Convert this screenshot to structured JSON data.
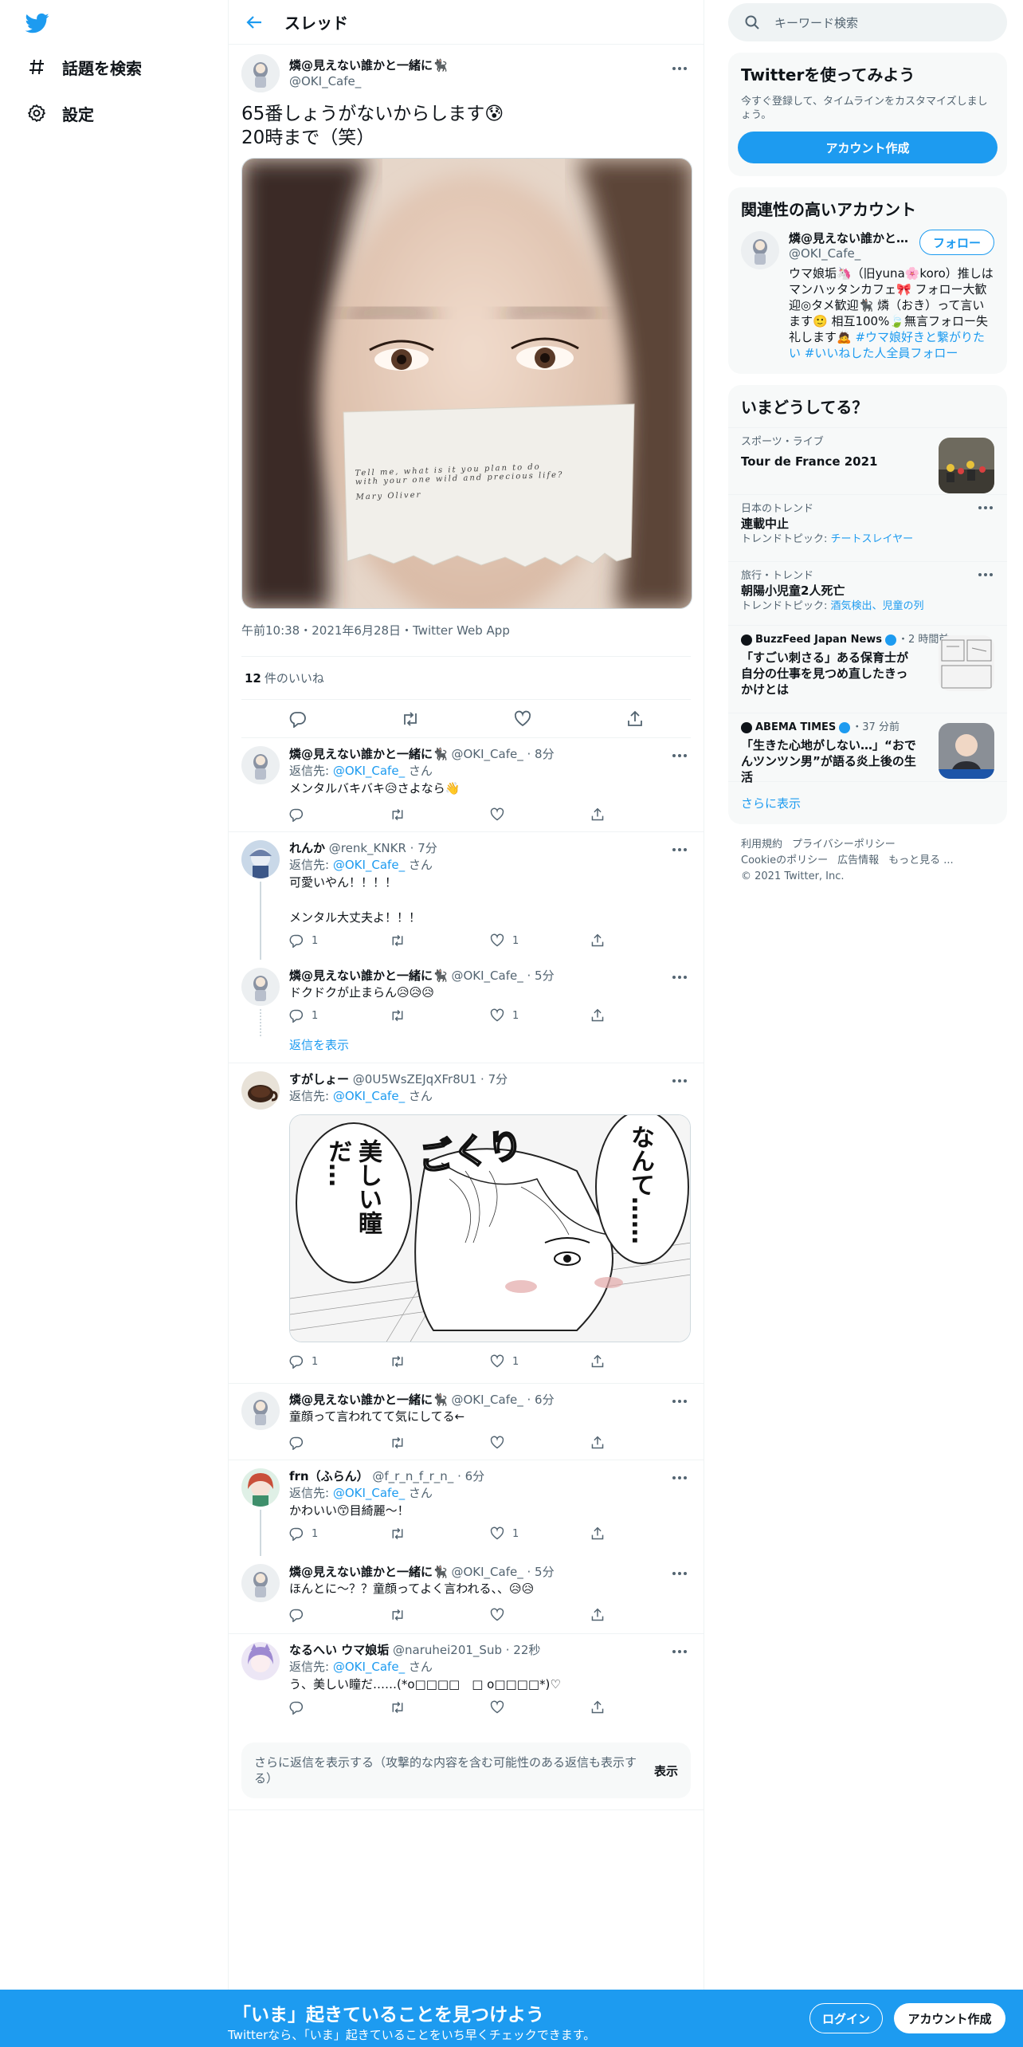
{
  "nav": {
    "explore": "話題を検索",
    "settings": "設定"
  },
  "header": {
    "title": "スレッド"
  },
  "main_tweet": {
    "display_name": "燐@見えない誰かと一緒に🐈‍⬛",
    "username": "@OKI_Cafe_",
    "text_line1": "65番しょうがないからします😰",
    "text_line2": "20時まで（笑）",
    "note_line1": "Tell me, what is it you plan to do",
    "note_line2": "with your one wild and precious life?",
    "note_author": "Mary Oliver",
    "timestamp": "午前10:38・2021年6月28日・Twitter Web App",
    "likes_count": "12",
    "likes_label": "件のいいね"
  },
  "replies": [
    {
      "display_name": "燐@見えない誰かと一緒に🐈‍⬛",
      "username": "@OKI_Cafe_",
      "time": "8分",
      "to_prefix": "返信先: ",
      "to_user": "@OKI_Cafe_",
      "to_suffix": "さん",
      "text": "メンタルバキバキ😥さよなら👋",
      "reply_count": "",
      "like_count": ""
    },
    {
      "display_name": "れんか",
      "username": "@renk_KNKR",
      "time": "7分",
      "to_prefix": "返信先: ",
      "to_user": "@OKI_Cafe_",
      "to_suffix": "さん",
      "text1": "可愛いやん！！！！",
      "text2": "メンタル大丈夫よ！！！",
      "reply_count": "1",
      "like_count": "1"
    },
    {
      "display_name": "燐@見えない誰かと一緒に🐈‍⬛",
      "username": "@OKI_Cafe_",
      "time": "5分",
      "text": "ドクドクが止まらん😥😥😥",
      "reply_count": "1",
      "like_count": "1"
    },
    {
      "display_name": "すがしょー",
      "username": "@0U5WsZEJqXFr8U1",
      "time": "7分",
      "to_prefix": "返信先: ",
      "to_user": "@OKI_Cafe_",
      "to_suffix": "さん",
      "manga_bubble1": "美しい瞳だ…",
      "manga_bubble2": "なんて……",
      "manga_sfx": "ごくり",
      "reply_count": "1",
      "like_count": "1"
    },
    {
      "display_name": "燐@見えない誰かと一緒に🐈‍⬛",
      "username": "@OKI_Cafe_",
      "time": "6分",
      "text": "童顔って言われてて気にしてる←"
    },
    {
      "display_name": "frn（ふらん）",
      "username": "@f_r_n_f_r_n_",
      "time": "6分",
      "to_prefix": "返信先: ",
      "to_user": "@OKI_Cafe_",
      "to_suffix": "さん",
      "text": "かわいい😙目綺麗〜！",
      "reply_count": "1",
      "like_count": "1"
    },
    {
      "display_name": "燐@見えない誰かと一緒に🐈‍⬛",
      "username": "@OKI_Cafe_",
      "time": "5分",
      "text": "ほんとに〜？？童顔ってよく言われる、、😥😥"
    },
    {
      "display_name": "なるへい ウマ娘垢",
      "username": "@naruhei201_Sub",
      "time": "22秒",
      "to_prefix": "返信先: ",
      "to_user": "@OKI_Cafe_",
      "to_suffix": "さん",
      "text": "う、美しい瞳だ……(*o□□□□　□ o□□□□*)♡"
    }
  ],
  "show_replies": "返信を表示",
  "more_replies": {
    "text": "さらに返信を表示する（攻撃的な内容を含む可能性のある返信も表示する）",
    "button": "表示"
  },
  "right": {
    "search_placeholder": "キーワード検索",
    "promo_title": "Twitterを使ってみよう",
    "promo_text": "今すぐ登録して、タイムラインをカスタマイズしましょう。",
    "promo_button": "アカウント作成",
    "related_title": "関連性の高いアカウント",
    "related_name": "燐@見えない誰かと…",
    "related_username": "@OKI_Cafe_",
    "follow_button": "フォロー",
    "related_bio": "ウマ娘垢🦄（旧yuna🌸koro）推しはマンハッタンカフェ🎀 フォロー大歓迎◎タメ歓迎🐈‍⬛ 燐（おき）って言います🙂 相互100%🍃無言フォロー失礼します🙇",
    "related_bio_tags": "#ウマ娘好きと繋がりたい #いいねした人全員フォロー",
    "trends_title": "いまどうしてる？",
    "trends": [
      {
        "category": "スポーツ・ライブ",
        "name": "Tour de France 2021",
        "topic_prefix": "",
        "topic": ""
      },
      {
        "category": "日本のトレンド",
        "name": "連載中止",
        "topic_prefix": "トレンドトピック: ",
        "topic": "チートスレイヤー"
      },
      {
        "category": "旅行・トレンド",
        "name": "朝陽小児童2人死亡",
        "topic_prefix": "トレンドトピック: ",
        "topic": "酒気検出、児童の列"
      },
      {
        "category": "BuzzFeed Japan News",
        "time": "・2 時間前",
        "name": "「すごい刺さる」ある保育士が自分の仕事を見つめ直したきっかけとは"
      },
      {
        "category": "ABEMA TIMES",
        "time": "・37 分前",
        "name": "「生きた心地がしない…」“おでんツンツン男”が語る炎上後の生活"
      }
    ],
    "show_more": "さらに表示",
    "footer_line1": [
      "利用規約",
      "プライバシーポリシー"
    ],
    "footer_line2": [
      "Cookieのポリシー",
      "広告情報",
      "もっと見る ..."
    ],
    "copyright": "© 2021 Twitter, Inc."
  },
  "bottom": {
    "headline": "「いま」起きていることを見つけよう",
    "sub": "Twitterなら、「いま」起きていることをいち早くチェックできます。",
    "login": "ログイン",
    "signup": "アカウント作成"
  },
  "colors": {
    "accent": "#1d9bf0",
    "text": "#0f1419",
    "muted": "#536471",
    "panel": "#f7f9f9"
  }
}
